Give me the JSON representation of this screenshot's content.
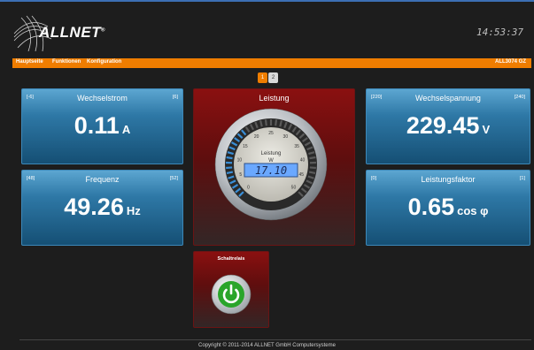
{
  "header": {
    "brand": "ALLNET",
    "registered": "®",
    "clock": "14:53:37"
  },
  "nav": {
    "items": [
      "Hauptseite",
      "Funktionen",
      "Konfiguration"
    ],
    "device": "ALL3074 GZ"
  },
  "pager": {
    "pages": [
      "1",
      "2"
    ],
    "active": "1"
  },
  "tiles": {
    "wechselstrom": {
      "title": "Wechselstrom",
      "min": "[-6]",
      "max": "[6]",
      "value": "0.11",
      "unit": "A"
    },
    "frequenz": {
      "title": "Frequenz",
      "min": "[48]",
      "max": "[52]",
      "value": "49.26",
      "unit": "Hz"
    },
    "wechselspannung": {
      "title": "Wechselspannung",
      "min": "[220]",
      "max": "[240]",
      "value": "229.45",
      "unit": "V"
    },
    "leistungsfaktor": {
      "title": "Leistungsfaktor",
      "min": "[0]",
      "max": "[1]",
      "value": "0.65",
      "unit": "cos φ"
    }
  },
  "leistung": {
    "title": "Leistung",
    "gauge_label": "Leistung",
    "gauge_unit": "W",
    "display": "17.10",
    "ticks": [
      "0",
      "5",
      "10",
      "15",
      "20",
      "25",
      "30",
      "35",
      "40",
      "45",
      "50"
    ]
  },
  "relay": {
    "title": "Schaltrelais",
    "state": "on"
  },
  "footer": {
    "copyright": "Copyright © 2011-2014 ALLNET GmbH Computersysteme"
  },
  "colors": {
    "accent": "#ef7d00",
    "tile_blue": "#2e78a6",
    "tile_red": "#8a1010",
    "power_on": "#2aa52a",
    "lcd": "#6aa8ff"
  }
}
